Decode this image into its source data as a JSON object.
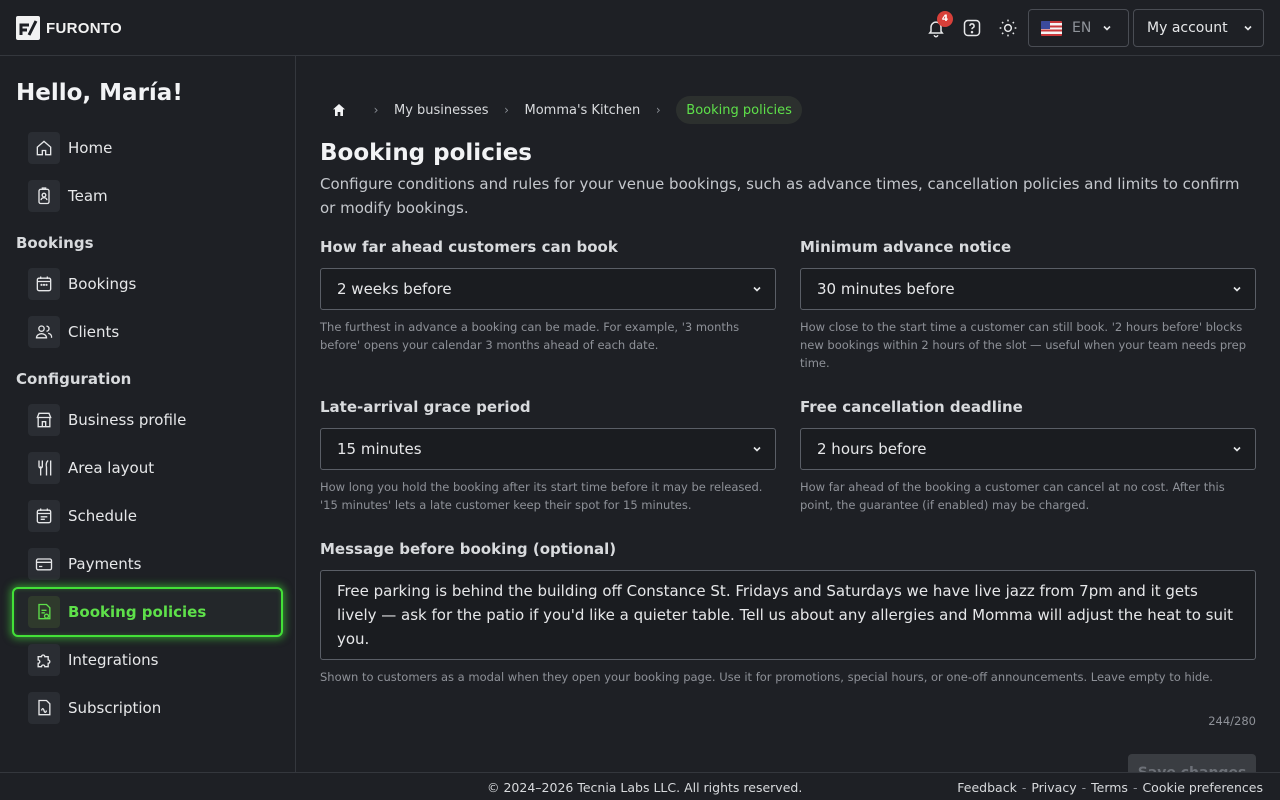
{
  "header": {
    "brand": "FURONTO",
    "notifications_count": "4",
    "language": "EN",
    "account_label": "My account",
    "icons": [
      "bell-icon",
      "help-icon",
      "sun-icon",
      "us-flag-icon",
      "chevron-down-icon"
    ]
  },
  "sidebar": {
    "greeting": "Hello, María!",
    "items": [
      {
        "label": "Home",
        "icon": "home-icon"
      },
      {
        "label": "Team",
        "icon": "badge-icon"
      }
    ],
    "bookings_section": "Bookings",
    "bookings_items": [
      {
        "label": "Bookings",
        "icon": "calendar-icon"
      },
      {
        "label": "Clients",
        "icon": "users-icon"
      }
    ],
    "config_section": "Configuration",
    "config_items": [
      {
        "label": "Business profile",
        "icon": "store-icon"
      },
      {
        "label": "Area layout",
        "icon": "utensils-icon"
      },
      {
        "label": "Schedule",
        "icon": "schedule-icon"
      },
      {
        "label": "Payments",
        "icon": "card-icon"
      },
      {
        "label": "Booking policies",
        "icon": "policy-icon",
        "active": true
      },
      {
        "label": "Integrations",
        "icon": "puzzle-icon"
      },
      {
        "label": "Subscription",
        "icon": "subscription-icon"
      }
    ],
    "accent_color": "#43e038"
  },
  "breadcrumb": {
    "items": [
      "My businesses",
      "Momma's Kitchen"
    ],
    "current": "Booking policies"
  },
  "page": {
    "title": "Booking policies",
    "description": "Configure conditions and rules for your venue bookings, such as advance times, cancellation policies and limits to confirm or modify bookings."
  },
  "fields": {
    "advance": {
      "label": "How far ahead customers can book",
      "value": "2 weeks before",
      "help": "The furthest in advance a booking can be made. For example, '3 months before' opens your calendar 3 months ahead of each date."
    },
    "min_notice": {
      "label": "Minimum advance notice",
      "value": "30 minutes before",
      "help": "How close to the start time a customer can still book. '2 hours before' blocks new bookings within 2 hours of the slot — useful when your team needs prep time."
    },
    "grace": {
      "label": "Late-arrival grace period",
      "value": "15 minutes",
      "help": "How long you hold the booking after its start time before it may be released. '15 minutes' lets a late customer keep their spot for 15 minutes."
    },
    "cancellation": {
      "label": "Free cancellation deadline",
      "value": "2 hours before",
      "help": "How far ahead of the booking a customer can cancel at no cost. After this point, the guarantee (if enabled) may be charged."
    },
    "message": {
      "label": "Message before booking (optional)",
      "value": "Free parking is behind the building off Constance St. Fridays and Saturdays we have live jazz from 7pm and it gets lively — ask for the patio if you'd like a quieter table. Tell us about any allergies and Momma will adjust the heat to suit you.",
      "help": "Shown to customers as a modal when they open your booking page. Use it for promotions, special hours, or one-off announcements. Leave empty to hide.",
      "counter": "244/280"
    }
  },
  "actions": {
    "save_label": "Save changes"
  },
  "footer": {
    "copyright": "© 2024–2026 Tecnia Labs LLC. All rights reserved.",
    "links": [
      "Feedback",
      "Privacy",
      "Terms",
      "Cookie preferences"
    ],
    "separator": "-"
  }
}
